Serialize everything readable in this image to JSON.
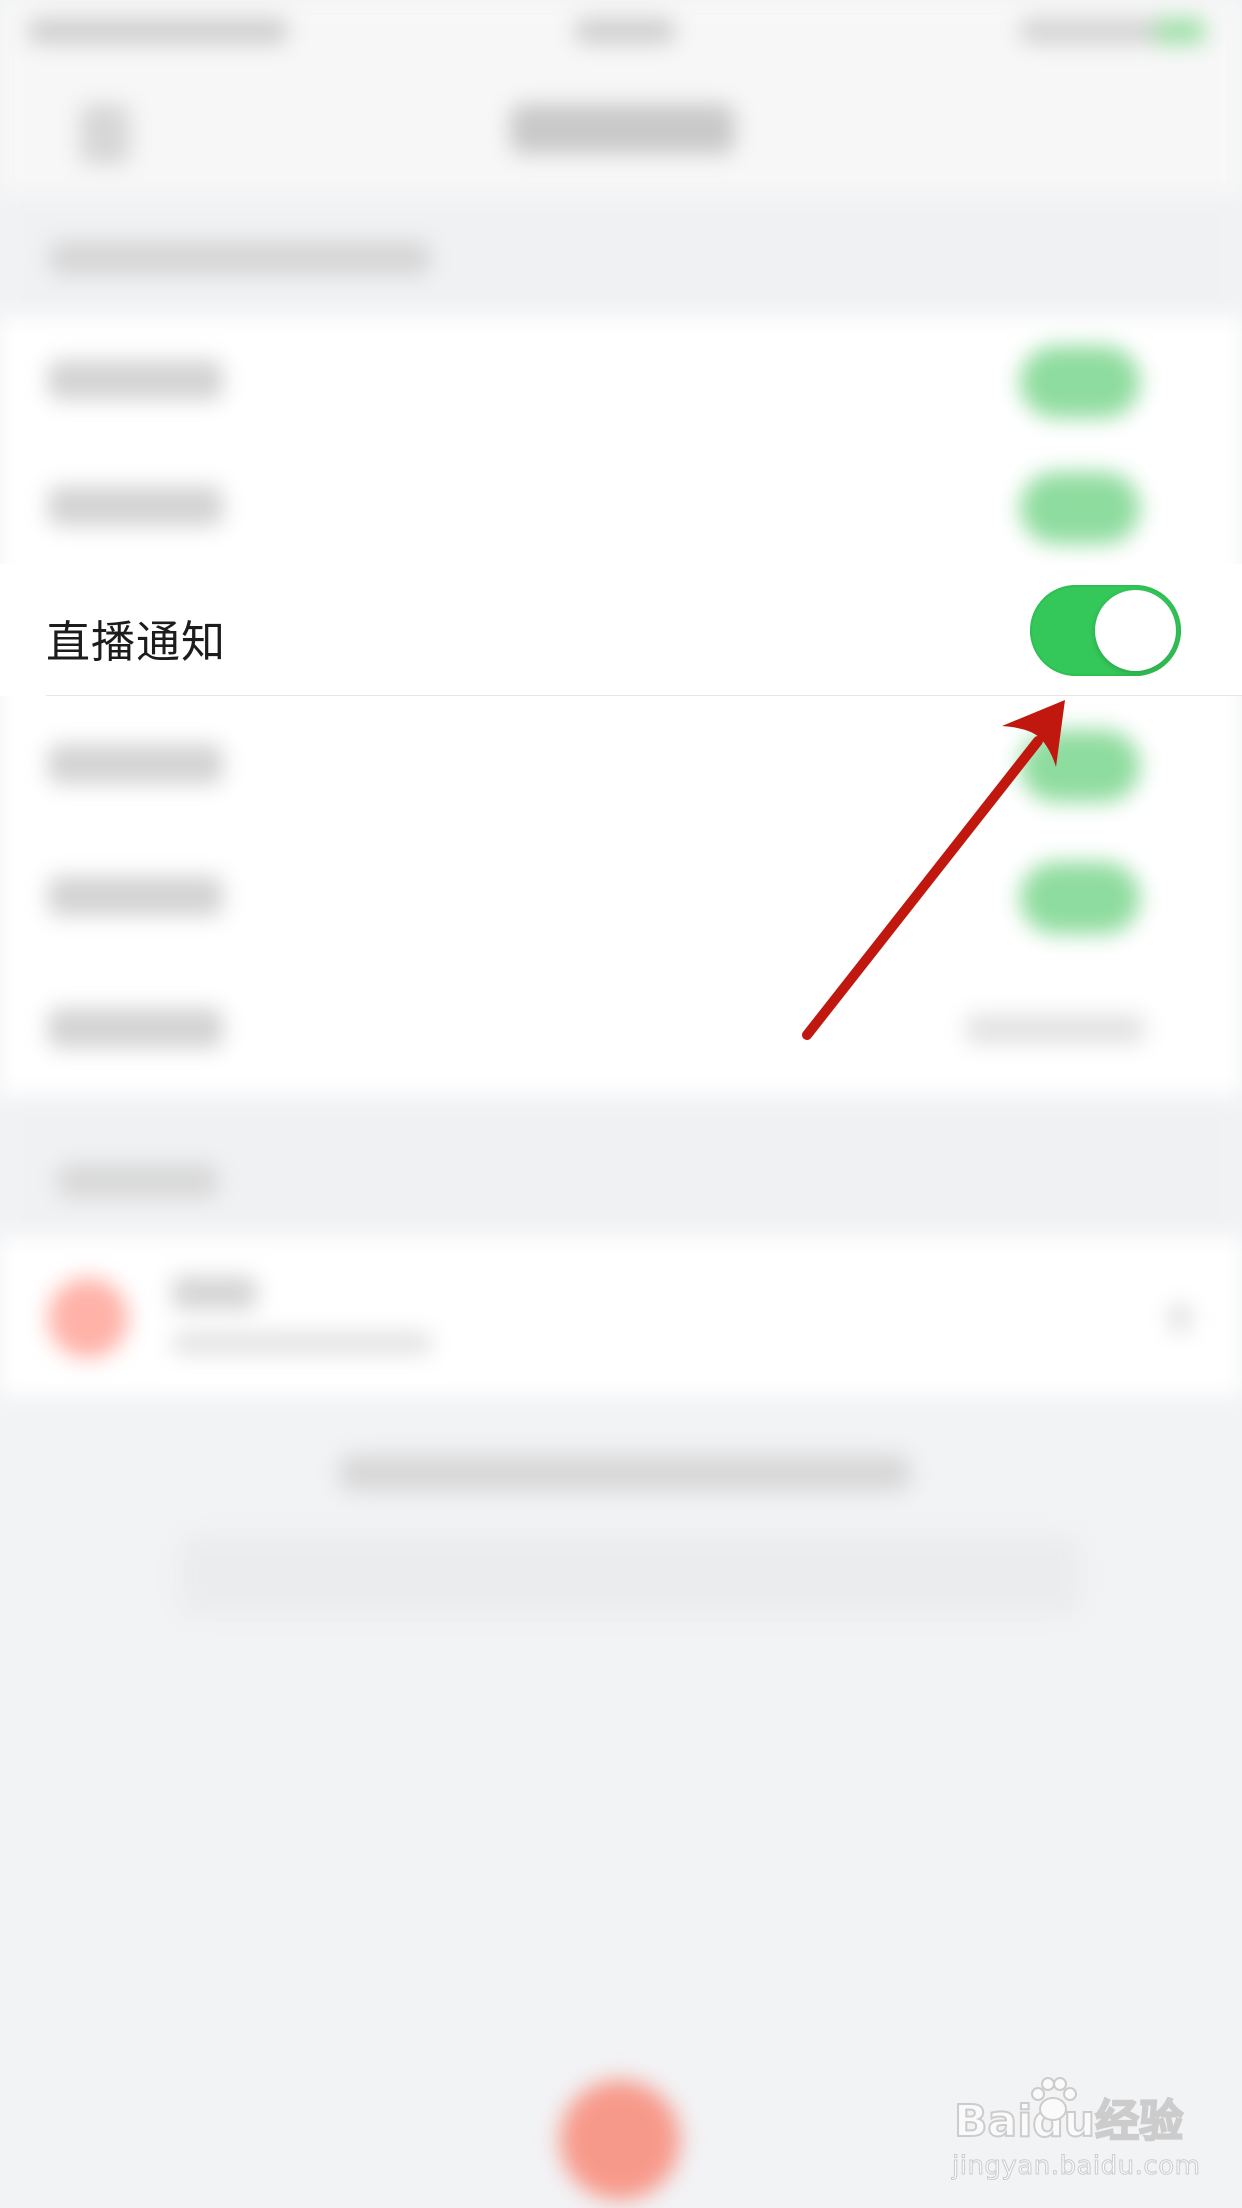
{
  "settings": {
    "focus_row": {
      "label": "直播通知",
      "toggle_on": true
    }
  },
  "colors": {
    "toggle_on": "#34c759",
    "annotation_arrow": "#c0170f"
  },
  "icons": {
    "annotation": "arrow-annotation-icon",
    "watermark_logo": "baidu-paw-icon"
  },
  "watermark": {
    "main": "Baidu经验",
    "url": "jingyan.baidu.com"
  }
}
